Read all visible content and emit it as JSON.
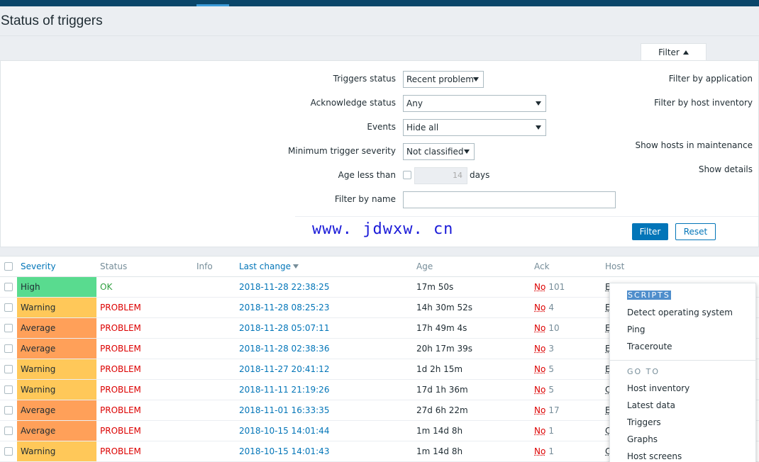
{
  "page": {
    "title": "Status of triggers"
  },
  "filter": {
    "tab_label": "Filter",
    "triggers_status": {
      "label": "Triggers status",
      "value": "Recent problem"
    },
    "acknowledge_status": {
      "label": "Acknowledge status",
      "value": "Any"
    },
    "events": {
      "label": "Events",
      "value": "Hide all"
    },
    "min_severity": {
      "label": "Minimum trigger severity",
      "value": "Not classified"
    },
    "age": {
      "label": "Age less than",
      "value": "14",
      "unit": "days"
    },
    "name": {
      "label": "Filter by name",
      "value": ""
    },
    "right_links": {
      "application": "Filter by application",
      "inventory": "Filter by host inventory",
      "maintenance": "Show hosts in maintenance",
      "details": "Show details"
    },
    "filter_button": "Filter",
    "reset_button": "Reset"
  },
  "watermark": "www. jdwxw. cn",
  "table": {
    "headers": {
      "severity": "Severity",
      "status": "Status",
      "info": "Info",
      "last_change": "Last change",
      "age": "Age",
      "ack": "Ack",
      "host": "Host"
    },
    "rows": [
      {
        "severity": "High",
        "sev_color": "#59db8f",
        "status": "OK",
        "status_type": "ok",
        "last_change": "2018-11-28 22:38:25",
        "age": "17m 50s",
        "ack": "No",
        "ack_count": "101",
        "host": "E"
      },
      {
        "severity": "Warning",
        "sev_color": "#ffc859",
        "status": "PROBLEM",
        "status_type": "problem",
        "last_change": "2018-11-28 08:25:23",
        "age": "14h 30m 52s",
        "ack": "No",
        "ack_count": "4",
        "host": "E"
      },
      {
        "severity": "Average",
        "sev_color": "#ffa059",
        "status": "PROBLEM",
        "status_type": "problem",
        "last_change": "2018-11-28 05:07:11",
        "age": "17h 49m 4s",
        "ack": "No",
        "ack_count": "10",
        "host": "E"
      },
      {
        "severity": "Average",
        "sev_color": "#ffa059",
        "status": "PROBLEM",
        "status_type": "problem",
        "last_change": "2018-11-28 02:38:36",
        "age": "20h 17m 39s",
        "ack": "No",
        "ack_count": "3",
        "host": "E"
      },
      {
        "severity": "Warning",
        "sev_color": "#ffc859",
        "status": "PROBLEM",
        "status_type": "problem",
        "last_change": "2018-11-27 20:41:12",
        "age": "1d 2h 15m",
        "ack": "No",
        "ack_count": "5",
        "host": "E"
      },
      {
        "severity": "Warning",
        "sev_color": "#ffc859",
        "status": "PROBLEM",
        "status_type": "problem",
        "last_change": "2018-11-11 21:19:26",
        "age": "17d 1h 36m",
        "ack": "No",
        "ack_count": "5",
        "host": "C"
      },
      {
        "severity": "Average",
        "sev_color": "#ffa059",
        "status": "PROBLEM",
        "status_type": "problem",
        "last_change": "2018-11-01 16:33:35",
        "age": "27d 6h 22m",
        "ack": "No",
        "ack_count": "17",
        "host": "E"
      },
      {
        "severity": "Average",
        "sev_color": "#ffa059",
        "status": "PROBLEM",
        "status_type": "problem",
        "last_change": "2018-10-15 14:01:44",
        "age": "1m 14d 8h",
        "ack": "No",
        "ack_count": "1",
        "host": "C"
      },
      {
        "severity": "Warning",
        "sev_color": "#ffc859",
        "status": "PROBLEM",
        "status_type": "problem",
        "last_change": "2018-10-15 14:01:43",
        "age": "1m 14d 8h",
        "ack": "No",
        "ack_count": "1",
        "host": "C"
      }
    ]
  },
  "context_menu": {
    "scripts_header": "SCRIPTS",
    "scripts": [
      "Detect operating system",
      "Ping",
      "Traceroute"
    ],
    "goto_header": "GO TO",
    "goto": [
      "Host inventory",
      "Latest data",
      "Triggers",
      "Graphs",
      "Host screens"
    ]
  }
}
